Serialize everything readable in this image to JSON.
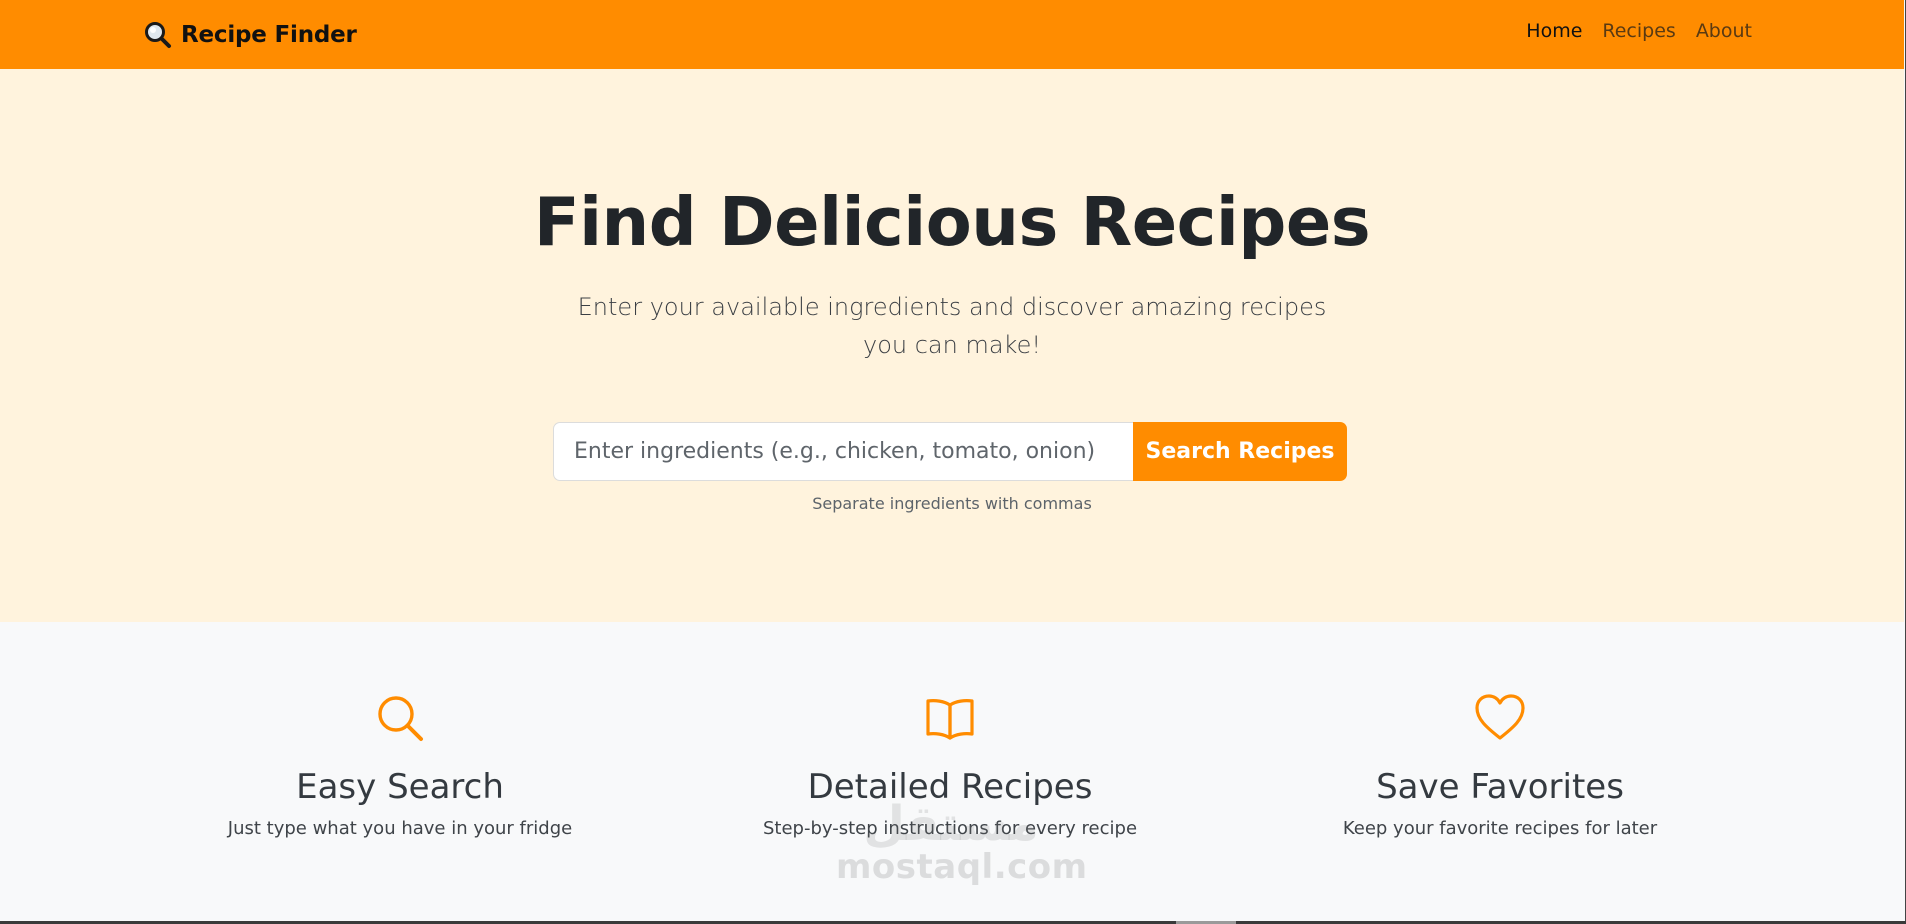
{
  "navbar": {
    "brand_name": "Recipe Finder",
    "brand_icon": "magnifying-glass-icon",
    "background_color": "#ff8c00",
    "links": [
      {
        "label": "Home",
        "active": true
      },
      {
        "label": "Recipes",
        "active": false
      },
      {
        "label": "About",
        "active": false
      }
    ]
  },
  "hero": {
    "title": "Find Delicious Recipes",
    "subtitle": "Enter your available ingredients and discover amazing recipes you can make!",
    "background_color": "#fff3dd",
    "search": {
      "placeholder": "Enter ingredients (e.g., chicken, tomato, onion)",
      "value": "",
      "button_label": "Search Recipes",
      "help_text": "Separate ingredients with commas"
    }
  },
  "features": [
    {
      "icon": "search-icon",
      "title": "Easy Search",
      "description": "Just type what you have in your fridge"
    },
    {
      "icon": "book-icon",
      "title": "Detailed Recipes",
      "description": "Step-by-step instructions for every recipe"
    },
    {
      "icon": "heart-icon",
      "title": "Save Favorites",
      "description": "Keep your favorite recipes for later"
    }
  ],
  "accent_color": "#ff8c00",
  "watermark": {
    "arabic": "مستقل",
    "latin": "mostaql.com"
  }
}
